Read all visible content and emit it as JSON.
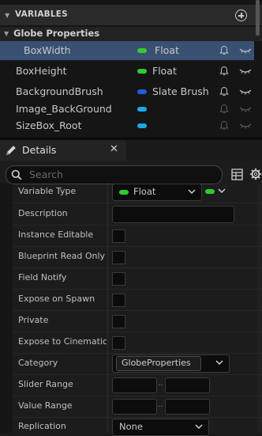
{
  "variables": {
    "header": "VARIABLES",
    "category": "Globe Properties",
    "items": [
      {
        "name": "BoxWidth",
        "type": "Float",
        "pill_color": "#2ecc2e",
        "selected": true
      },
      {
        "name": "BoxHeight",
        "type": "Float",
        "pill_color": "#2ecc2e",
        "selected": false
      },
      {
        "name": "BackgroundBrush",
        "type": "Slate Brush",
        "pill_color": "#1f5fd6",
        "selected": false
      },
      {
        "name": "Image_BackGround",
        "type": "",
        "pill_color": "#1aa8e8",
        "selected": false
      },
      {
        "name": "SizeBox_Root",
        "type": "",
        "pill_color": "#1aa8e8",
        "selected": false
      }
    ]
  },
  "details": {
    "tab_label": "Details",
    "search_placeholder": "Search",
    "properties": [
      {
        "label": "Variable Type",
        "kind": "type",
        "value": "Float"
      },
      {
        "label": "Description",
        "kind": "text",
        "value": ""
      },
      {
        "label": "Instance Editable",
        "kind": "check"
      },
      {
        "label": "Blueprint Read Only",
        "kind": "check"
      },
      {
        "label": "Field Notify",
        "kind": "check"
      },
      {
        "label": "Expose on Spawn",
        "kind": "check"
      },
      {
        "label": "Private",
        "kind": "check"
      },
      {
        "label": "Expose to Cinematics",
        "kind": "check"
      },
      {
        "label": "Category",
        "kind": "category",
        "value": "GlobeProperties"
      },
      {
        "label": "Slider Range",
        "kind": "range",
        "separator": ".."
      },
      {
        "label": "Value Range",
        "kind": "range",
        "separator": ".."
      },
      {
        "label": "Replication",
        "kind": "combo",
        "value": "None"
      }
    ]
  }
}
